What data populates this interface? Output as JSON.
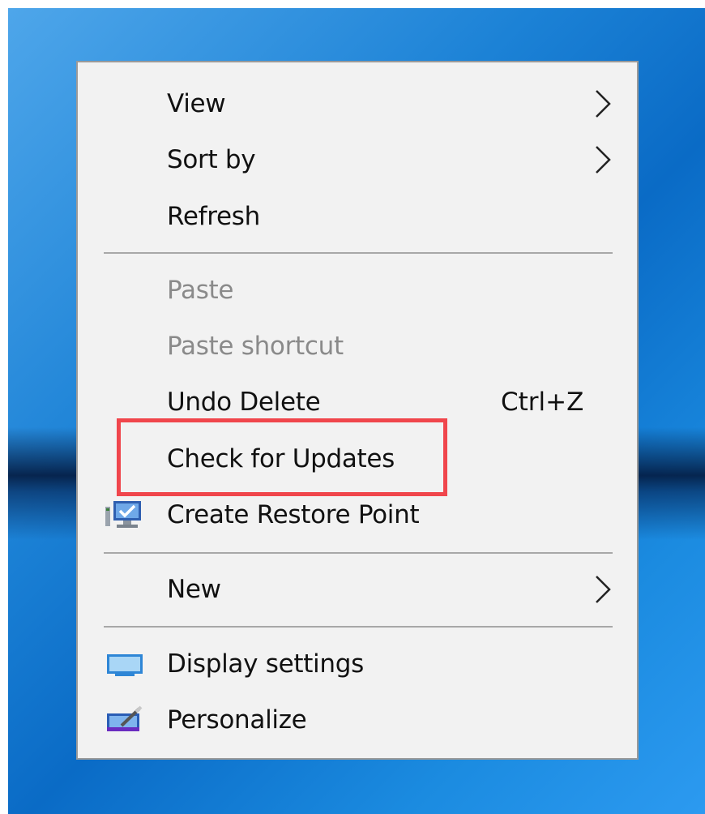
{
  "context_menu": {
    "items": [
      {
        "label": "View",
        "submenu": true
      },
      {
        "label": "Sort by",
        "submenu": true
      },
      {
        "label": "Refresh"
      },
      {
        "label": "Paste",
        "disabled": true
      },
      {
        "label": "Paste shortcut",
        "disabled": true
      },
      {
        "label": "Undo Delete",
        "shortcut": "Ctrl+Z"
      },
      {
        "label": "Check for Updates",
        "highlighted": true
      },
      {
        "label": "Create Restore Point",
        "icon": "system-restore-icon"
      },
      {
        "label": "New",
        "submenu": true
      },
      {
        "label": "Display settings",
        "icon": "display-icon"
      },
      {
        "label": "Personalize",
        "icon": "personalize-icon"
      }
    ]
  },
  "colors": {
    "menu_background": "#f2f2f2",
    "menu_border": "#9a9a9a",
    "disabled_text": "#8a8a8a",
    "highlight_box": "#f0464c",
    "desktop_blue": "#0a6bc6"
  }
}
